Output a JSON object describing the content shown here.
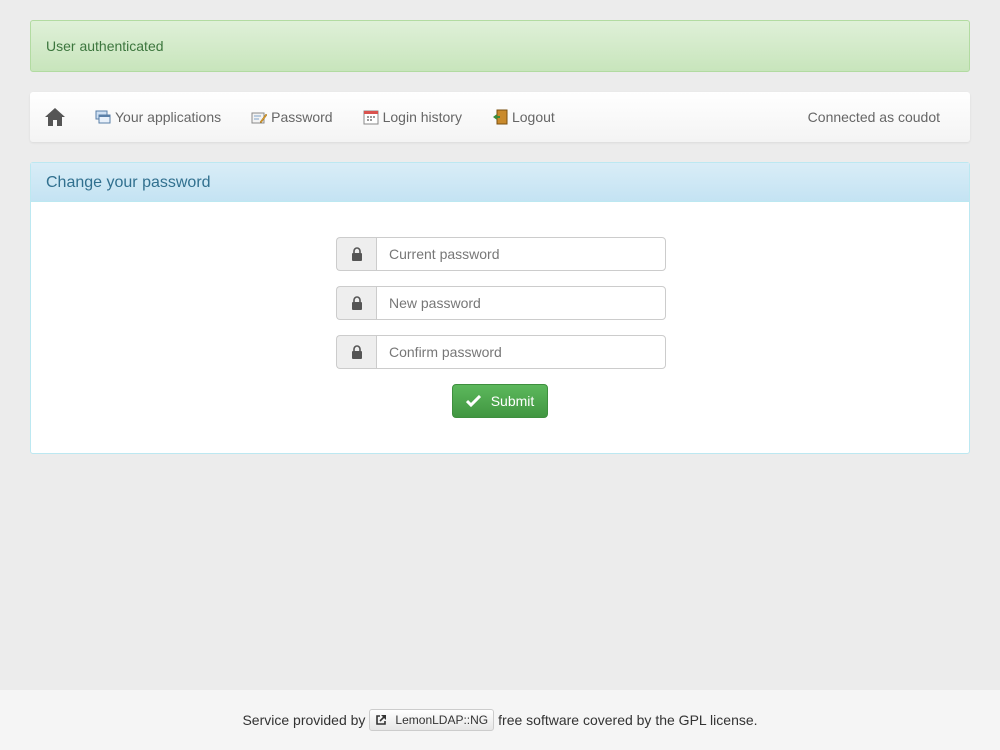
{
  "alert": {
    "message": "User authenticated"
  },
  "navbar": {
    "home_icon": "home-icon",
    "items": [
      {
        "label": "Your applications",
        "icon": "applications-icon"
      },
      {
        "label": "Password",
        "icon": "password-icon"
      },
      {
        "label": "Login history",
        "icon": "calendar-icon"
      },
      {
        "label": "Logout",
        "icon": "logout-icon"
      }
    ],
    "connected": "Connected as coudot"
  },
  "panel": {
    "title": "Change your password",
    "fields": [
      {
        "placeholder": "Current password",
        "icon": "lock-icon"
      },
      {
        "placeholder": "New password",
        "icon": "lock-icon"
      },
      {
        "placeholder": "Confirm password",
        "icon": "lock-icon"
      }
    ],
    "submit_label": "Submit"
  },
  "footer": {
    "prefix": "Service provided by",
    "link_label": "LemonLDAP::NG",
    "suffix": "free software covered by the GPL license."
  },
  "colors": {
    "success": "#3c763d",
    "info": "#31708f",
    "button": "#5cb85c"
  }
}
